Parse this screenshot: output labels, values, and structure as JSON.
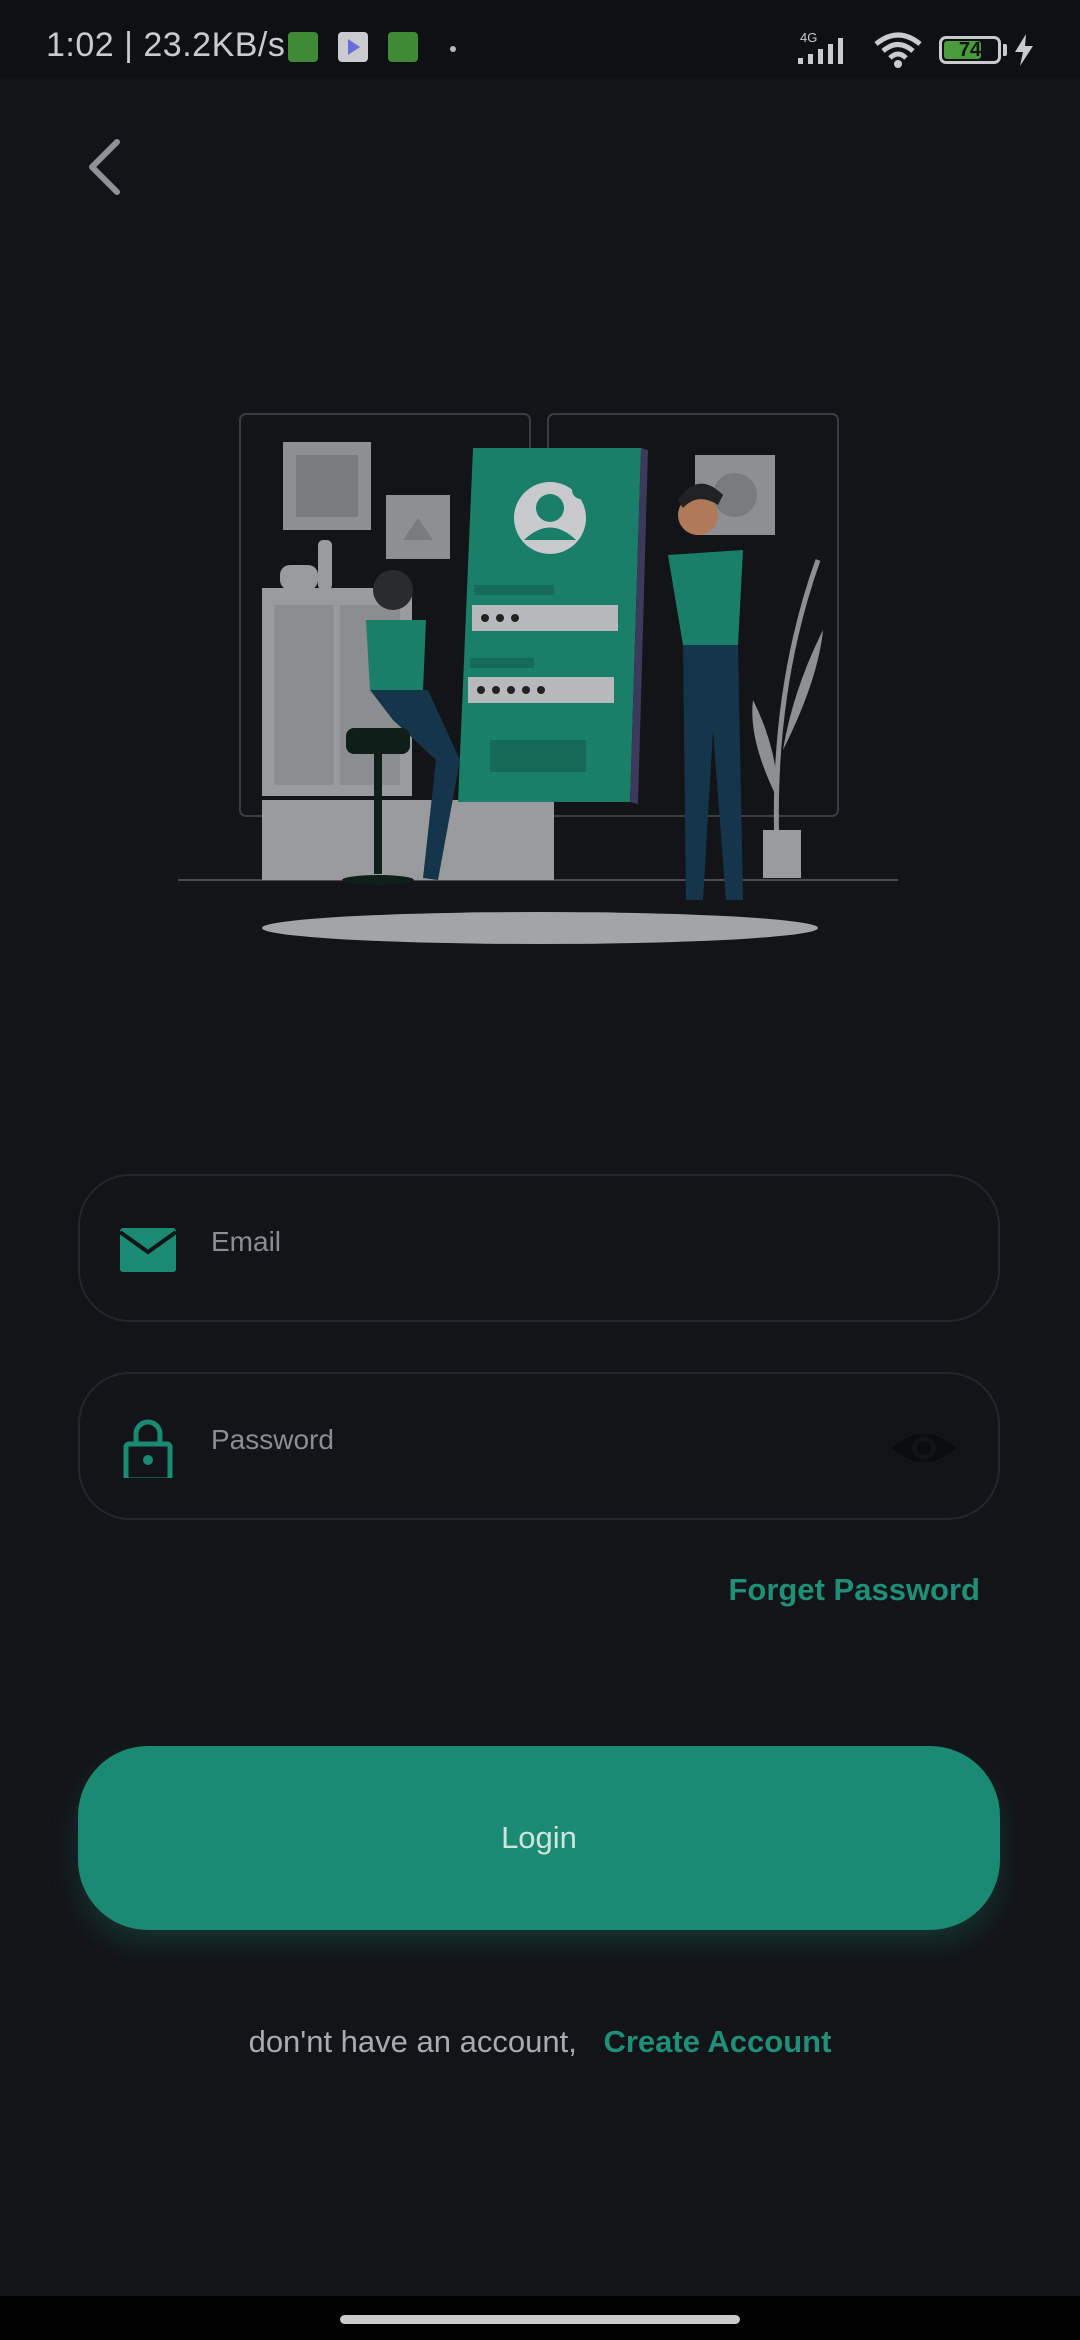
{
  "status_bar": {
    "time_speed": "1:02 | 23.2KB/s",
    "network": "4G",
    "battery": "74",
    "battery_level": 0.74
  },
  "navigation": {
    "back_icon": "chevron-left-icon"
  },
  "illustration": {
    "icon": "login-illustration"
  },
  "form": {
    "email_placeholder": "Email",
    "email_icon": "mail-icon",
    "password_placeholder": "Password",
    "password_icon": "lock-icon",
    "visibility_icon": "eye-icon",
    "forget_label": "Forget Password",
    "login_label": "Login"
  },
  "footer": {
    "prompt": "don'nt have an account,",
    "link": "Create Account"
  },
  "colors": {
    "accent": "#1a8a72",
    "background": "#131418"
  }
}
